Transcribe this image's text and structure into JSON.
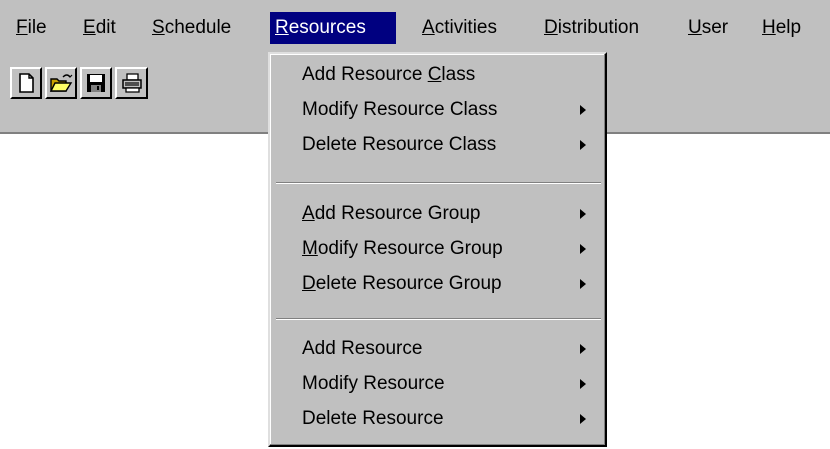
{
  "menubar": {
    "items": [
      {
        "pre": "",
        "ul": "F",
        "post": "ile"
      },
      {
        "pre": "",
        "ul": "E",
        "post": "dit"
      },
      {
        "pre": "",
        "ul": "S",
        "post": "chedule"
      },
      {
        "pre": "",
        "ul": "R",
        "post": "esources"
      },
      {
        "pre": "",
        "ul": "A",
        "post": "ctivities"
      },
      {
        "pre": "",
        "ul": "D",
        "post": "istribution"
      },
      {
        "pre": "",
        "ul": "U",
        "post": "ser"
      },
      {
        "pre": "",
        "ul": "H",
        "post": "elp"
      }
    ]
  },
  "toolbar": {
    "buttons": [
      "new-file-icon",
      "open-folder-icon",
      "save-disk-icon",
      "print-icon"
    ]
  },
  "resources_menu": {
    "items": [
      {
        "pre": "Add Resource ",
        "ul": "C",
        "post": "lass",
        "submenu": false
      },
      {
        "pre": "Modify Resource Class",
        "ul": "",
        "post": "",
        "submenu": true
      },
      {
        "pre": "Delete Resource Class",
        "ul": "",
        "post": "",
        "submenu": true
      },
      {
        "pre": "",
        "ul": "A",
        "post": "dd Resource Group",
        "submenu": true
      },
      {
        "pre": "",
        "ul": "M",
        "post": "odify Resource Group",
        "submenu": true
      },
      {
        "pre": "",
        "ul": "D",
        "post": "elete Resource Group",
        "submenu": true
      },
      {
        "pre": "Add Resource",
        "ul": "",
        "post": "",
        "submenu": true
      },
      {
        "pre": "Modify Resource",
        "ul": "",
        "post": "",
        "submenu": true
      },
      {
        "pre": "Delete Resource",
        "ul": "",
        "post": "",
        "submenu": true
      }
    ]
  }
}
